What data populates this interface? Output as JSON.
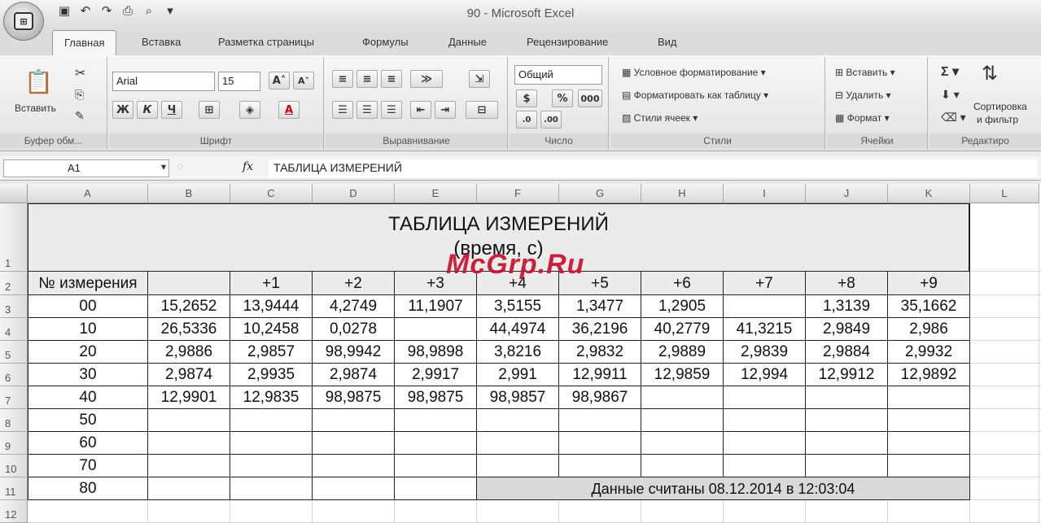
{
  "window": {
    "title": "90 - Microsoft Excel"
  },
  "ribbon_tabs": [
    "Главная",
    "Вставка",
    "Разметка страницы",
    "Формулы",
    "Данные",
    "Рецензирование",
    "Вид"
  ],
  "clipboard": {
    "paste": "Вставить",
    "label": "Буфер обм..."
  },
  "font": {
    "name": "Arial",
    "size": "15",
    "bold": "Ж",
    "italic": "К",
    "underline": "Ч",
    "label": "Шрифт"
  },
  "alignment": {
    "label": "Выравнивание"
  },
  "number": {
    "format": "Общий",
    "label": "Число"
  },
  "styles": {
    "conditional": "Условное форматирование",
    "as_table": "Форматировать как таблицу",
    "cell_styles": "Стили ячеек",
    "label": "Стили"
  },
  "cells": {
    "insert": "Вставить",
    "delete": "Удалить",
    "format": "Формат",
    "label": "Ячейки"
  },
  "editing": {
    "sort_line1": "Сортировка",
    "sort_line2": "и фильтр",
    "label": "Редактиро"
  },
  "formula_bar": {
    "name_box": "A1",
    "fx": "fx",
    "content": "ТАБЛИЦА ИЗМЕРЕНИЙ"
  },
  "columns": [
    "A",
    "B",
    "C",
    "D",
    "E",
    "F",
    "G",
    "H",
    "I",
    "J",
    "K",
    "L"
  ],
  "rows": [
    "1",
    "2",
    "3",
    "4",
    "5",
    "6",
    "7",
    "8",
    "9",
    "10",
    "11",
    "12"
  ],
  "sheet": {
    "title_line1": "ТАБЛИЦА ИЗМЕРЕНИЙ",
    "title_line2": "(время, с)",
    "header": [
      "№ измерения",
      "",
      "+1",
      "+2",
      "+3",
      "+4",
      "+5",
      "+6",
      "+7",
      "+8",
      "+9"
    ],
    "data": [
      [
        "00",
        "15,2652",
        "13,9444",
        "4,2749",
        "11,1907",
        "3,5155",
        "1,3477",
        "1,2905",
        "",
        "1,3139",
        "35,1662"
      ],
      [
        "10",
        "26,5336",
        "10,2458",
        "0,0278",
        "",
        "44,4974",
        "36,2196",
        "40,2779",
        "41,3215",
        "2,9849",
        "2,986"
      ],
      [
        "20",
        "2,9886",
        "2,9857",
        "98,9942",
        "98,9898",
        "3,8216",
        "2,9832",
        "2,9889",
        "2,9839",
        "2,9884",
        "2,9932"
      ],
      [
        "30",
        "2,9874",
        "2,9935",
        "2,9874",
        "2,9917",
        "2,991",
        "12,9911",
        "12,9859",
        "12,994",
        "12,9912",
        "12,9892"
      ],
      [
        "40",
        "12,9901",
        "12,9835",
        "98,9875",
        "98,9875",
        "98,9857",
        "98,9867",
        "",
        "",
        "",
        ""
      ],
      [
        "50",
        "",
        "",
        "",
        "",
        "",
        "",
        "",
        "",
        "",
        ""
      ],
      [
        "60",
        "",
        "",
        "",
        "",
        "",
        "",
        "",
        "",
        "",
        ""
      ],
      [
        "70",
        "",
        "",
        "",
        "",
        "",
        "",
        "",
        "",
        "",
        ""
      ]
    ],
    "last_row_label": "80",
    "footer_note": "Данные считаны 08.12.2014 в 12:03:04"
  },
  "watermark": "McGrp.Ru"
}
